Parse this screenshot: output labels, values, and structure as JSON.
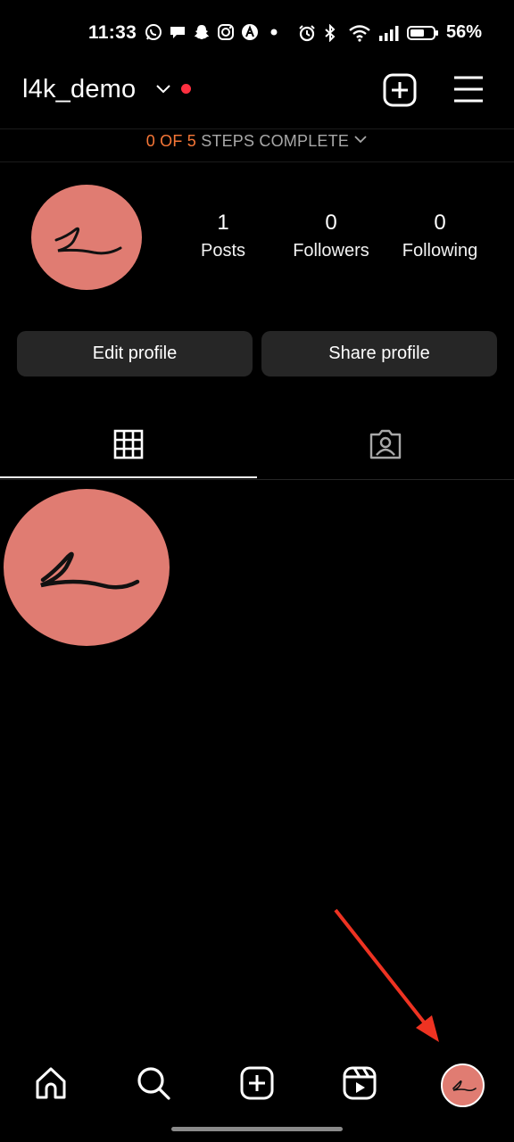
{
  "status_bar": {
    "time": "11:33",
    "battery": "56%",
    "left_icons": [
      "whatsapp-icon",
      "chat-icon",
      "snapchat-icon",
      "instagram-icon",
      "arc-icon",
      "dot-icon"
    ],
    "right_icons": [
      "alarm-icon",
      "bluetooth-icon",
      "wifi-icon",
      "signal-icon",
      "battery-icon"
    ]
  },
  "header": {
    "username": "l4k_demo",
    "notification_dot_color": "#ff3040"
  },
  "steps": {
    "progress": "0 OF 5",
    "label": "STEPS COMPLETE"
  },
  "profile": {
    "avatar_color": "#e07c72",
    "stats": [
      {
        "value": "1",
        "label": "Posts"
      },
      {
        "value": "0",
        "label": "Followers"
      },
      {
        "value": "0",
        "label": "Following"
      }
    ],
    "buttons": {
      "edit": "Edit profile",
      "share": "Share profile"
    }
  },
  "tabs": {
    "active": "grid",
    "items": [
      "grid-icon",
      "tagged-icon"
    ]
  },
  "posts": [
    {
      "type": "signature-avatar-image"
    }
  ],
  "bottom_nav": {
    "items": [
      "home-icon",
      "search-icon",
      "create-icon",
      "reels-icon",
      "profile-avatar"
    ],
    "active": "profile-avatar"
  },
  "annotation": {
    "arrow_color": "#ee3322",
    "points_to": "profile-avatar"
  }
}
